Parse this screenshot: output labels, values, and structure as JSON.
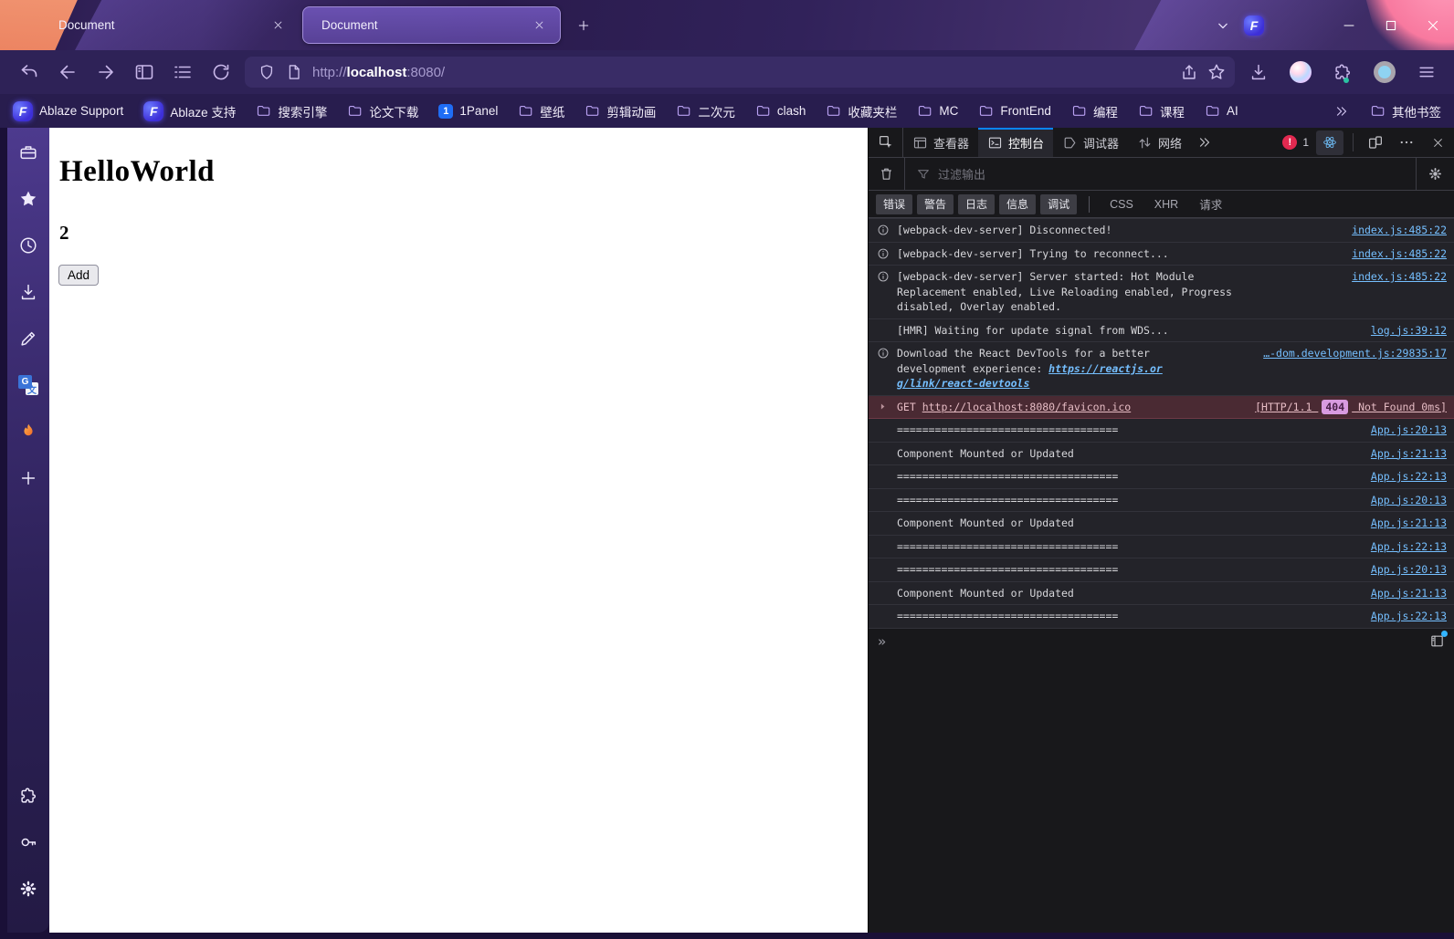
{
  "titlebar": {
    "tabs": [
      {
        "title": "Document",
        "active": false
      },
      {
        "title": "Document",
        "active": true
      }
    ],
    "right_icons": [
      {
        "icon": "chevron-down",
        "name": "tab-list-button"
      },
      {
        "icon": "floorp-logo",
        "name": "browser-logo"
      }
    ],
    "window_buttons": [
      {
        "icon": "minimize",
        "name": "minimize-button"
      },
      {
        "icon": "maximize",
        "name": "maximize-button"
      },
      {
        "icon": "close-x",
        "name": "close-window-button"
      }
    ]
  },
  "navbar": {
    "left_icons": [
      {
        "icon": "undo-arrow",
        "name": "undo-button"
      },
      {
        "icon": "back-arrow",
        "name": "back-button"
      },
      {
        "icon": "forward-arrow",
        "name": "forward-button"
      },
      {
        "icon": "split-view",
        "name": "sidebar-toggle-button"
      },
      {
        "icon": "reader-list",
        "name": "reader-list-button"
      },
      {
        "icon": "reload",
        "name": "reload-button"
      }
    ],
    "url": {
      "prefix": "http://",
      "host": "localhost",
      "suffix": ":8080/"
    },
    "urlbar_left_icons": [
      {
        "icon": "shield",
        "name": "tracking-protection-icon"
      },
      {
        "icon": "page",
        "name": "site-info-icon"
      }
    ],
    "urlbar_right_icons": [
      {
        "icon": "share",
        "name": "share-button"
      },
      {
        "icon": "star",
        "name": "bookmark-page-button"
      }
    ],
    "right_icons": [
      {
        "icon": "download",
        "name": "downloads-button"
      },
      {
        "icon": "avatar",
        "name": "account-avatar"
      },
      {
        "icon": "puzzle",
        "name": "extensions-button",
        "dot": true
      },
      {
        "icon": "profile",
        "name": "profile-button"
      },
      {
        "icon": "hamburger",
        "name": "app-menu-button"
      }
    ]
  },
  "bookmarks_bar": {
    "items": [
      {
        "label": "Ablaze Support",
        "icon": "floorp-logo"
      },
      {
        "label": "Ablaze 支持",
        "icon": "floorp-logo"
      },
      {
        "label": "搜索引擎",
        "icon": "folder"
      },
      {
        "label": "论文下载",
        "icon": "folder"
      },
      {
        "label": "1Panel",
        "icon": "1panel-logo"
      },
      {
        "label": "壁纸",
        "icon": "folder"
      },
      {
        "label": "剪辑动画",
        "icon": "folder"
      },
      {
        "label": "二次元",
        "icon": "folder"
      },
      {
        "label": "clash",
        "icon": "folder"
      },
      {
        "label": "收藏夹栏",
        "icon": "folder"
      },
      {
        "label": "MC",
        "icon": "folder"
      },
      {
        "label": "FrontEnd",
        "icon": "folder"
      },
      {
        "label": "编程",
        "icon": "folder"
      },
      {
        "label": "课程",
        "icon": "folder"
      },
      {
        "label": "AI",
        "icon": "folder"
      }
    ],
    "overflow_icon": "chevrons-right",
    "other_bookmarks": {
      "label": "其他书签",
      "icon": "folder"
    }
  },
  "sidebar": {
    "top_icons": [
      {
        "icon": "toolbox",
        "name": "browser-manager"
      },
      {
        "icon": "star-filled",
        "name": "bookmarks"
      },
      {
        "icon": "clock",
        "name": "history"
      },
      {
        "icon": "download",
        "name": "downloads"
      },
      {
        "icon": "pencil",
        "name": "notes"
      },
      {
        "icon": "translate",
        "name": "translate"
      },
      {
        "icon": "flame",
        "name": "flame-extension"
      },
      {
        "icon": "plus",
        "name": "add-panel"
      }
    ],
    "bottom_icons": [
      {
        "icon": "puzzle",
        "name": "addons"
      },
      {
        "icon": "key",
        "name": "passwords"
      },
      {
        "icon": "gear",
        "name": "settings"
      }
    ]
  },
  "page": {
    "heading": "HelloWorld",
    "count": "2",
    "add_button_label": "Add"
  },
  "devtools": {
    "accent": "#0a84ff",
    "toolbar": {
      "tabs": [
        {
          "label": "查看器",
          "icon": "inspector-icon",
          "active": false
        },
        {
          "label": "控制台",
          "icon": "console-icon",
          "active": true
        },
        {
          "label": "调试器",
          "icon": "debugger-icon",
          "active": false
        },
        {
          "label": "网络",
          "icon": "network-icon",
          "active": false
        }
      ],
      "error_count": "1"
    },
    "filter_bar": {
      "placeholder": "过滤输出"
    },
    "filter_chips": [
      "错误",
      "警告",
      "日志",
      "信息",
      "调试"
    ],
    "text_filters": [
      "CSS",
      "XHR",
      "请求"
    ],
    "messages": [
      {
        "type": "info",
        "text": "[webpack-dev-server] Disconnected!",
        "source": "index.js:485:22"
      },
      {
        "type": "info",
        "text": "[webpack-dev-server] Trying to reconnect...",
        "source": "index.js:485:22"
      },
      {
        "type": "info",
        "text": "[webpack-dev-server] Server started: Hot Module\nReplacement enabled, Live Reloading enabled, Progress\ndisabled, Overlay enabled.",
        "source": "index.js:485:22"
      },
      {
        "type": "log",
        "text": "[HMR] Waiting for update signal from WDS...",
        "source": "log.js:39:12"
      },
      {
        "type": "info",
        "text": "Download the React DevTools for a better\ndevelopment experience: ",
        "link": "https://reactjs.or\ng/link/react-devtools",
        "source": "…-dom.development.js:29835:17"
      },
      {
        "type": "network",
        "method": "GET",
        "url": "http://localhost:8080/favicon.ico",
        "status_open": "[HTTP/1.1",
        "status_code": "404",
        "status_close": "Not Found 0ms]"
      },
      {
        "type": "log",
        "text": "===================================",
        "source": "App.js:20:13"
      },
      {
        "type": "log",
        "text": "Component Mounted or Updated",
        "source": "App.js:21:13"
      },
      {
        "type": "log",
        "text": "===================================",
        "source": "App.js:22:13"
      },
      {
        "type": "log",
        "text": "===================================",
        "source": "App.js:20:13"
      },
      {
        "type": "log",
        "text": "Component Mounted or Updated",
        "source": "App.js:21:13"
      },
      {
        "type": "log",
        "text": "===================================",
        "source": "App.js:22:13"
      },
      {
        "type": "log",
        "text": "===================================",
        "source": "App.js:20:13"
      },
      {
        "type": "log",
        "text": "Component Mounted or Updated",
        "source": "App.js:21:13"
      },
      {
        "type": "log",
        "text": "===================================",
        "source": "App.js:22:13"
      }
    ],
    "prompt_symbol": "»"
  }
}
